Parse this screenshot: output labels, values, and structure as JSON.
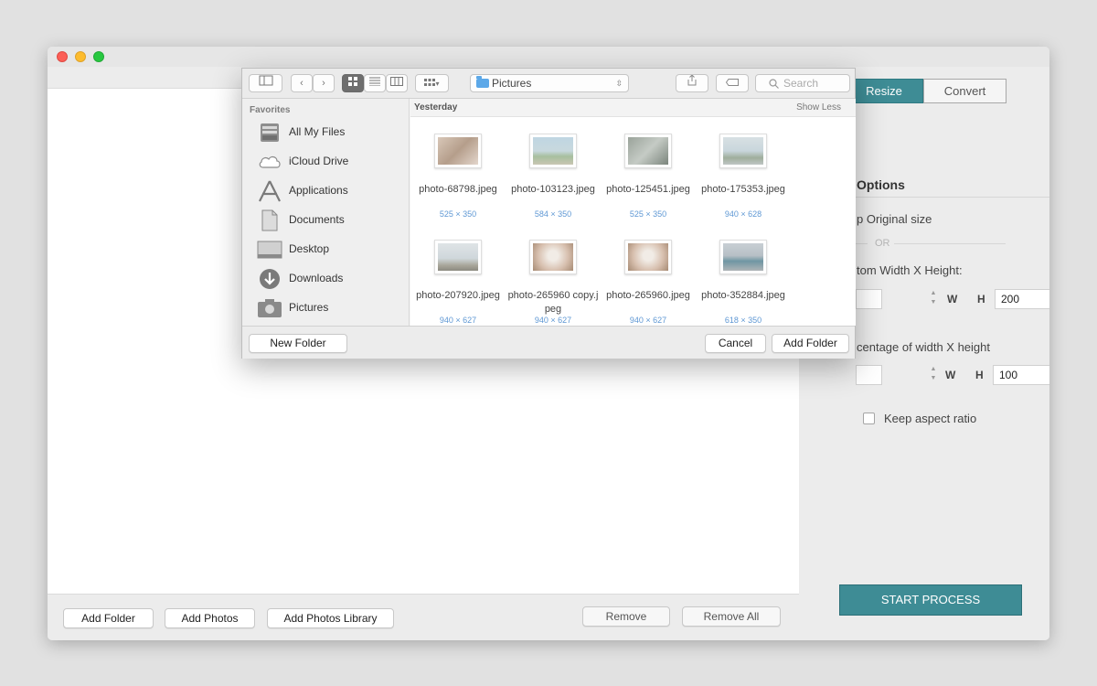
{
  "app": {
    "bottom_buttons": {
      "add_folder": "Add Folder",
      "add_photos": "Add Photos",
      "add_photos_library": "Add Photos Library",
      "remove": "Remove",
      "remove_all": "Remove All"
    }
  },
  "right_panel": {
    "tabs": {
      "resize": "Resize",
      "convert": "Convert"
    },
    "options_title": "Options",
    "keep_original": "p Original size",
    "or_label": "OR",
    "custom_label": "tom Width X Height:",
    "custom_width": "",
    "custom_height": "200",
    "w_label": "W",
    "h_label": "H",
    "percentage_label": "centage of width X height",
    "percent_width": "",
    "percent_height": "100",
    "keep_aspect": "Keep aspect ratio",
    "start_button": "START PROCESS",
    "accent_color": "#3e8c95"
  },
  "dialog": {
    "location": "Pictures",
    "search_placeholder": "Search",
    "favorites_label": "Favorites",
    "sidebar": [
      {
        "label": "All My Files",
        "icon": "all-files-icon"
      },
      {
        "label": "iCloud Drive",
        "icon": "cloud-icon"
      },
      {
        "label": "Applications",
        "icon": "applications-icon"
      },
      {
        "label": "Documents",
        "icon": "documents-icon"
      },
      {
        "label": "Desktop",
        "icon": "desktop-icon"
      },
      {
        "label": "Downloads",
        "icon": "downloads-icon"
      },
      {
        "label": "Pictures",
        "icon": "camera-icon"
      }
    ],
    "group": {
      "title": "Yesterday",
      "toggle": "Show Less"
    },
    "files": [
      {
        "name": "photo-68798.jpeg",
        "size": "525 × 350"
      },
      {
        "name": "photo-103123.jpeg",
        "size": "584 × 350"
      },
      {
        "name": "photo-125451.jpeg",
        "size": "525 × 350"
      },
      {
        "name": "photo-175353.jpeg",
        "size": "940 × 628"
      },
      {
        "name": "photo-207920.jpeg",
        "size": "940 × 627"
      },
      {
        "name": "photo-265960 copy.jpeg",
        "size": "940 × 627"
      },
      {
        "name": "photo-265960.jpeg",
        "size": "940 × 627"
      },
      {
        "name": "photo-352884.jpeg",
        "size": "618 × 350"
      }
    ],
    "new_folder": "New Folder",
    "cancel": "Cancel",
    "add_folder": "Add Folder"
  }
}
